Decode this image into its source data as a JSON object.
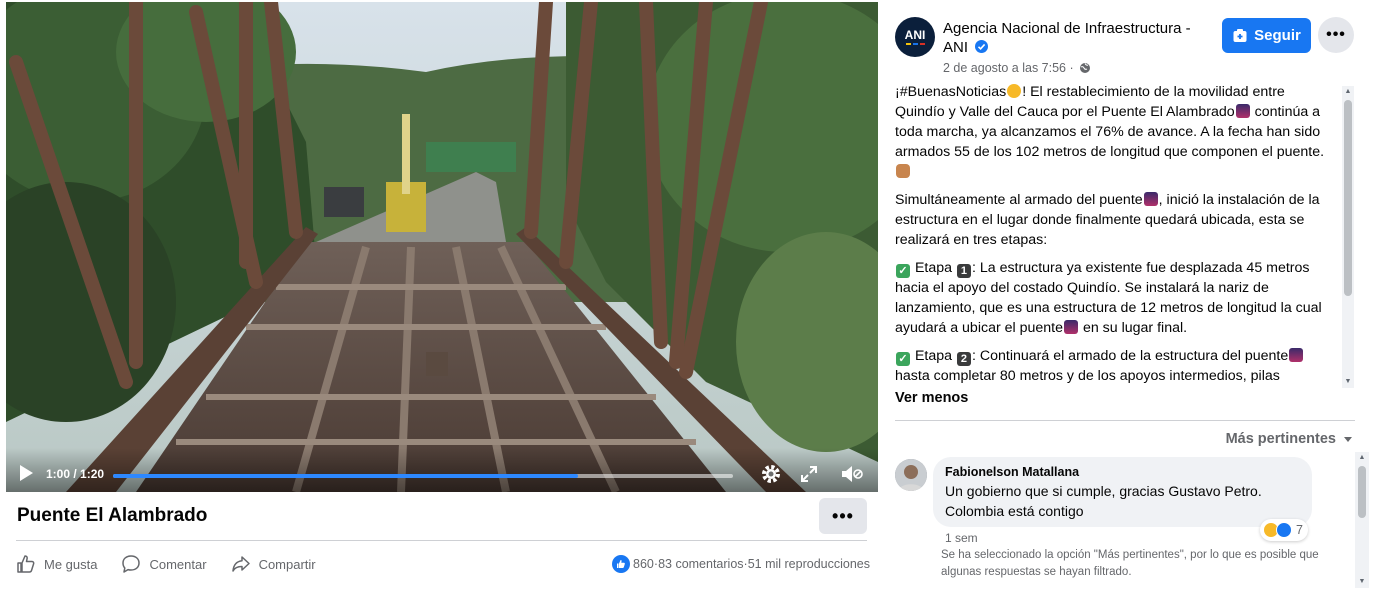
{
  "video": {
    "time_display": "1:00 / 1:20",
    "progress_fraction": 0.75,
    "title": "Puente El Alambrado",
    "more_label": "•••"
  },
  "actions": {
    "like": "Me gusta",
    "comment": "Comentar",
    "share": "Compartir"
  },
  "stats": {
    "likes": "860",
    "comments": "83 comentarios",
    "views": "51 mil reproducciones",
    "separator": " · "
  },
  "post": {
    "page_name": "Agencia Nacional de Infraestructura - ANI",
    "date": "2 de agosto a las 7:56 ·",
    "follow_label": "Seguir",
    "more_label": "•••",
    "avatar_text": "ANI",
    "p1_a": "¡#BuenasNoticias",
    "p1_b": "! El restablecimiento de la movilidad entre Quindío y Valle del Cauca por el Puente El Alambrado",
    "p1_c": " continúa a toda marcha, ya alcanzamos el 76% de avance. A la fecha han sido armados 55 de los 102 metros de longitud que componen el puente.",
    "p2_a": "Simultáneamente al armado del puente",
    "p2_b": ", inició la instalación de la estructura en el lugar donde finalmente quedará ubicada, esta se realizará en tres etapas:",
    "p3_a": " Etapa ",
    "p3_num": "1",
    "p3_b": ": La estructura ya existente fue desplazada 45 metros hacia el apoyo del costado Quindío. Se instalará la nariz de lanzamiento, que es una estructura de 12 metros de longitud la cual ayudará a ubicar el puente",
    "p3_c": " en su lugar final.",
    "p4_a": " Etapa ",
    "p4_num": "2",
    "p4_b": ": Continuará el armado de la estructura del puente",
    "p4_c": " hasta completar 80 metros y de los apoyos intermedios, pilas",
    "see_less": "Ver menos"
  },
  "comments": {
    "sort_label": "Más pertinentes",
    "items": [
      {
        "author": "Fabionelson Matallana",
        "text": "Un gobierno que si cumple, gracias Gustavo Petro. Colombia está contigo",
        "reactions": "7",
        "time": "1 sem"
      }
    ],
    "filter_note": "Se ha seleccionado la opción \"Más pertinentes\", por lo que es posible que algunas respuestas se hayan filtrado."
  },
  "colors": {
    "accent": "#1877f2",
    "progress": "#2d88ff"
  }
}
